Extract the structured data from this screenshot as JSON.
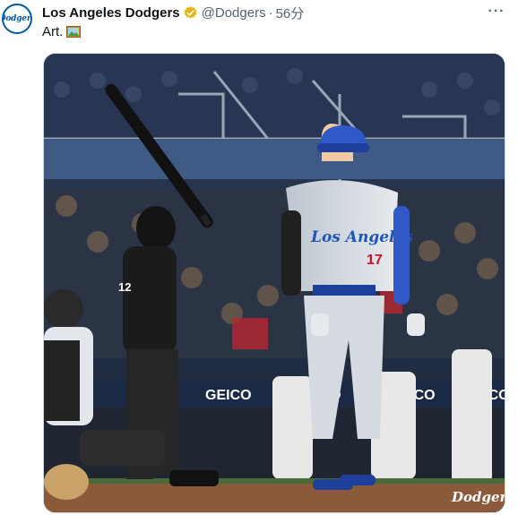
{
  "tweet": {
    "display_name": "Los Angeles Dodgers",
    "handle": "@Dodgers",
    "separator": "·",
    "time": "56分",
    "text": "Art.",
    "more_label": "···"
  },
  "avatar": {
    "wordmark": "Dodgers"
  },
  "media": {
    "alt": "Photo of Dodgers player watching a home run at the ballpark",
    "jersey_wordmark": "Los Angeles",
    "jersey_number": "17",
    "umpire_number": "12",
    "banner_sponsor": "GEICO",
    "watermark": "Dodgers"
  },
  "colors": {
    "dodger_blue": "#005a9c",
    "verified_gold": "#e2b719",
    "text_primary": "#0f1419",
    "text_secondary": "#536471"
  }
}
